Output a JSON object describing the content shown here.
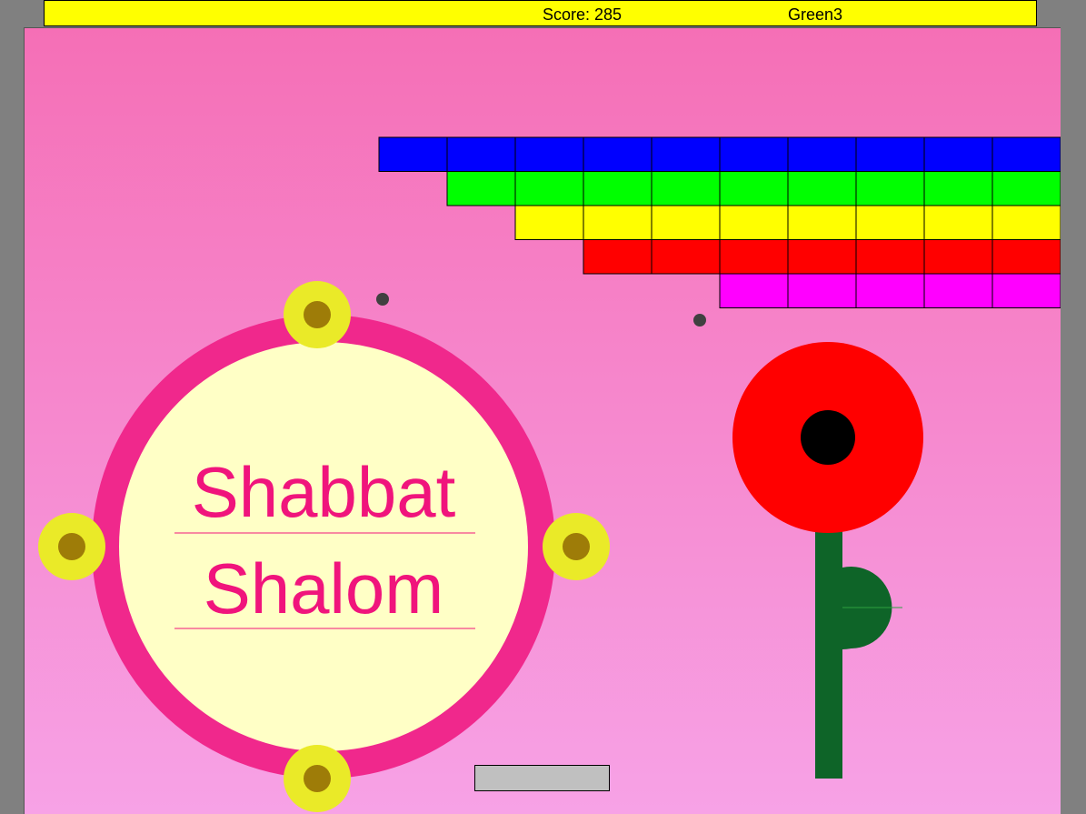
{
  "hud": {
    "score_label": "Score: 285",
    "level_name": "Green3"
  },
  "sign": {
    "line1": "Shabbat",
    "line2": "Shalom"
  },
  "colors": {
    "hud_background": "#ffff00",
    "playfield_top": "#f56fb6",
    "playfield_bottom": "#f7a2e6",
    "ring": "#f0288c",
    "sign_face": "#ffffc6",
    "sign_text": "#f0147c",
    "candle_outer": "#eaea28",
    "candle_inner": "#9e7c08",
    "flower_petal": "#ff0000",
    "flower_center": "#000000",
    "stem": "#0e6428",
    "paddle": "#c0c0c0",
    "ball": "#404040"
  },
  "bricks": {
    "row_colors": [
      "#0000ff",
      "#00ff00",
      "#ffff00",
      "#ff0000",
      "#ff00ff"
    ],
    "columns": 10,
    "row_start_columns": [
      0,
      1,
      2,
      3,
      5
    ]
  },
  "balls_count": 2,
  "icons": [
    "ball-icon",
    "paddle",
    "flower-icon",
    "candle-icon"
  ]
}
